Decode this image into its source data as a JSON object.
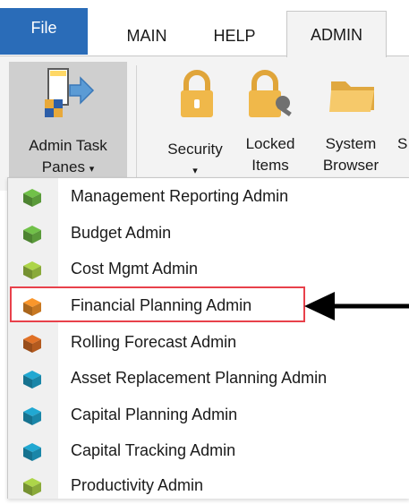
{
  "tabs": {
    "file": "File",
    "items": [
      {
        "label": "MAIN"
      },
      {
        "label": "HELP"
      },
      {
        "label": "ADMIN"
      }
    ]
  },
  "ribbon": {
    "admin_task_panes": {
      "line1": "Admin Task",
      "line2": "Panes",
      "caret": "▾"
    },
    "security": {
      "line1": "Security",
      "caret": "▾"
    },
    "locked_items": {
      "line1": "Locked",
      "line2": "Items"
    },
    "system_browser": {
      "line1": "System",
      "line2": "Browser"
    },
    "cut_off_label": "S"
  },
  "menu": {
    "items": [
      {
        "label": "Management Reporting Admin",
        "color": "#5a9a3a"
      },
      {
        "label": "Budget Admin",
        "color": "#5a9a3a"
      },
      {
        "label": "Cost Mgmt Admin",
        "color": "#8aaa3a"
      },
      {
        "label": "Financial Planning Admin",
        "color": "#c87822"
      },
      {
        "label": "Rolling Forecast Admin",
        "color": "#b35a1e"
      },
      {
        "label": "Asset Replacement Planning Admin",
        "color": "#1a86a8"
      },
      {
        "label": "Capital Planning Admin",
        "color": "#1a86a8"
      },
      {
        "label": "Capital Tracking Admin",
        "color": "#1a86a8"
      },
      {
        "label": "Productivity Admin",
        "color": "#8aaa3a"
      }
    ],
    "highlighted_index": 3
  },
  "colors": {
    "file_tab": "#2a6cb8",
    "highlight_border": "#e8414b",
    "lock_icon": "#f0b84a",
    "folder_icon": "#f0c060"
  }
}
